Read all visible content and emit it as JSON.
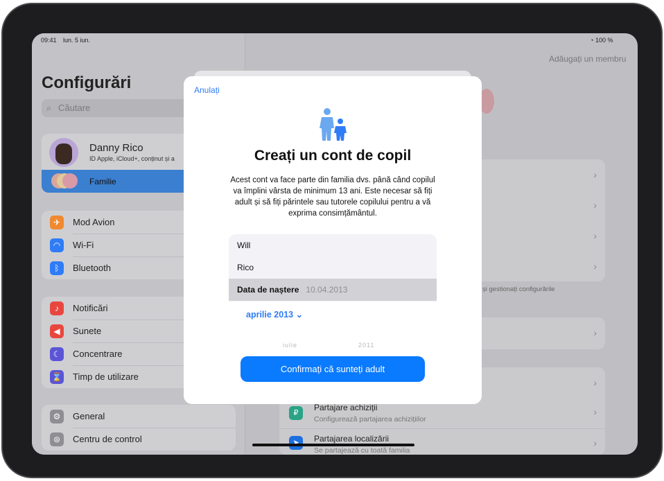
{
  "status_bar": {
    "time": "09:41",
    "date": "lun. 5 iun.",
    "battery": "100 %"
  },
  "sidebar": {
    "title": "Configurări",
    "search_placeholder": "Căutare",
    "profile": {
      "name": "Danny Rico",
      "subtitle": "ID Apple, iCloud+, conținut și a"
    },
    "family": "Familie",
    "group1": [
      {
        "label": "Mod Avion",
        "icon": "airplane-icon",
        "color": "#f0892f"
      },
      {
        "label": "Wi-Fi",
        "icon": "wifi-icon",
        "color": "#2f7cf6"
      },
      {
        "label": "Bluetooth",
        "icon": "bluetooth-icon",
        "color": "#2f7cf6"
      }
    ],
    "group2": [
      {
        "label": "Notificări",
        "icon": "bell-icon",
        "color": "#e8473f"
      },
      {
        "label": "Sunete",
        "icon": "speaker-icon",
        "color": "#e8473f"
      },
      {
        "label": "Concentrare",
        "icon": "moon-icon",
        "color": "#5b55d6"
      },
      {
        "label": "Timp de utilizare",
        "icon": "hourglass-icon",
        "color": "#5b55d6"
      }
    ],
    "group3": [
      {
        "label": "General",
        "icon": "gear-icon",
        "color": "#8e8e93"
      },
      {
        "label": "Centru de control",
        "icon": "toggles-icon",
        "color": "#8e8e93"
      }
    ]
  },
  "detail": {
    "add_member": "Adăugați un membru",
    "footer_note": "s. și gestionați configurările",
    "purchase_title": "Partajare achiziții",
    "purchase_sub": "Configurează partajarea achizițiilor",
    "location_title": "Partajarea localizării",
    "location_sub": "Se partajează cu toată familia"
  },
  "modal": {
    "cancel": "Anulați",
    "icon": "parent-child-icon",
    "title": "Creați un cont de copil",
    "body": "Acest cont va face parte din familia dvs. până când copilul va împlini vârsta de minimum 13 ani. Este necesar să fiți adult și să fiți părintele sau tutorele copilului pentru a vă exprima consimțământul.",
    "first_name": "Will",
    "last_name": "Rico",
    "dob_label": "Data de naștere",
    "dob_value": "10.04.2013",
    "month_year": "aprilie 2013",
    "picker_month": "iulie",
    "picker_year": "2011",
    "confirm": "Confirmați că sunteți adult"
  },
  "colors": {
    "accent": "#0a7aff",
    "selected": "#3b7fd0"
  }
}
